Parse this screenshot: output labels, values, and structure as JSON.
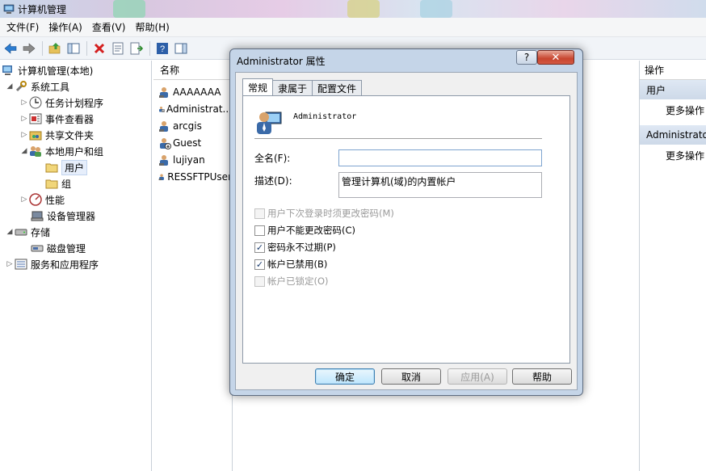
{
  "window": {
    "title": "计算机管理"
  },
  "menu": [
    "文件(F)",
    "操作(A)",
    "查看(V)",
    "帮助(H)"
  ],
  "tree": {
    "root": "计算机管理(本地)",
    "system_tools": "系统工具",
    "task_scheduler": "任务计划程序",
    "event_viewer": "事件查看器",
    "shared_folders": "共享文件夹",
    "local_users": "本地用户和组",
    "users": "用户",
    "groups": "组",
    "performance": "性能",
    "device_manager": "设备管理器",
    "storage": "存储",
    "disk_management": "磁盘管理",
    "services_apps": "服务和应用程序"
  },
  "list": {
    "header": "名称",
    "items": [
      "AAAAAAA",
      "Administrat...",
      "arcgis",
      "Guest",
      "lujiyan",
      "RESSFTPUser"
    ]
  },
  "actions": {
    "header": "操作",
    "section1": "用户",
    "more1": "更多操作",
    "section2": "Administrator",
    "more2": "更多操作"
  },
  "dialog": {
    "title": "Administrator 属性",
    "help_btn": "?",
    "close_btn": "✕",
    "tabs": [
      "常规",
      "隶属于",
      "配置文件"
    ],
    "username": "Administrator",
    "fullname_label": "全名(F):",
    "fullname_value": "",
    "description_label": "描述(D):",
    "description_value": "管理计算机(域)的内置帐户",
    "checkboxes": [
      {
        "label": "用户下次登录时须更改密码(M)",
        "checked": "",
        "disabled": true
      },
      {
        "label": "用户不能更改密码(C)",
        "checked": "",
        "disabled": false
      },
      {
        "label": "密码永不过期(P)",
        "checked": "✓",
        "disabled": false
      },
      {
        "label": "帐户已禁用(B)",
        "checked": "✓",
        "disabled": false
      },
      {
        "label": "帐户已锁定(O)",
        "checked": "",
        "disabled": true
      }
    ],
    "buttons": {
      "ok": "确定",
      "cancel": "取消",
      "apply": "应用(A)",
      "help": "帮助"
    }
  }
}
